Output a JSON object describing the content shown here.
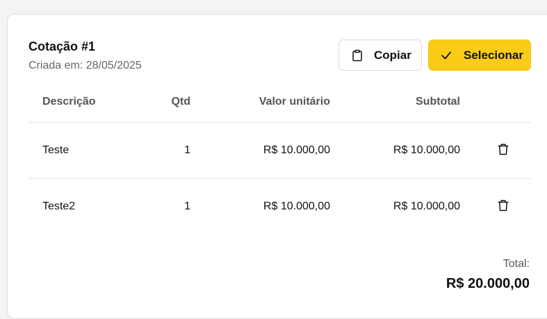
{
  "quote": {
    "title": "Cotação #1",
    "created": "Criada em: 28/05/2025"
  },
  "actions": {
    "copy_label": "Copiar",
    "copy_icon": "clipboard-icon",
    "select_label": "Selecionar",
    "select_icon": "check-icon",
    "accent_color": "#facc15"
  },
  "table": {
    "headers": [
      "Descrição",
      "Qtd",
      "Valor unitário",
      "Subtotal"
    ],
    "rows": [
      {
        "description": "Teste",
        "qty": "1",
        "unit_price": "R$ 10.000,00",
        "subtotal": "R$ 10.000,00",
        "action_icon": "trash-icon"
      },
      {
        "description": "Teste2",
        "qty": "1",
        "unit_price": "R$ 10.000,00",
        "subtotal": "R$ 10.000,00",
        "action_icon": "trash-icon"
      }
    ]
  },
  "total": {
    "label": "Total:",
    "value": "R$ 20.000,00"
  }
}
